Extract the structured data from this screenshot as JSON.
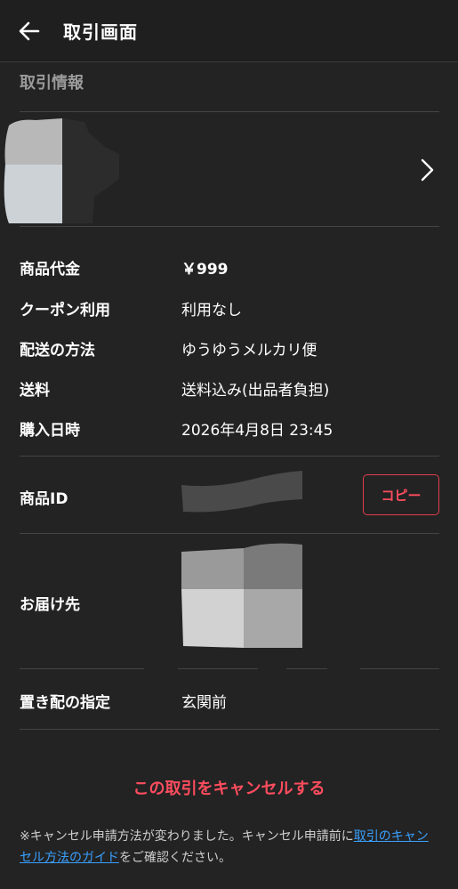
{
  "header": {
    "title": "取引画面",
    "back_icon": "arrow-left-icon"
  },
  "section": {
    "title": "取引情報"
  },
  "product": {
    "chevron_icon": "chevron-right-icon"
  },
  "details": [
    {
      "label": "商品代金",
      "value": "￥999"
    },
    {
      "label": "クーポン利用",
      "value": "利用なし"
    },
    {
      "label": "配送の方法",
      "value": "ゆうゆうメルカリ便"
    },
    {
      "label": "送料",
      "value": "送料込み(出品者負担)"
    },
    {
      "label": "購入日時",
      "value": "2026年4月8日 23:45"
    }
  ],
  "item_id": {
    "label": "商品ID",
    "copy_label": "コピー"
  },
  "address": {
    "label": "お届け先"
  },
  "placement": {
    "label": "置き配の指定",
    "value": "玄関前"
  },
  "cancel": {
    "label": "この取引をキャンセルする"
  },
  "notice": {
    "prefix": "※キャンセル申請方法が変わりました。キャンセル申請前に",
    "link": "取引のキャンセル方法のガイド",
    "suffix": "をご確認ください。"
  },
  "colors": {
    "accent": "#ff4d5e",
    "link": "#3aa0ff",
    "background": "#232323"
  }
}
